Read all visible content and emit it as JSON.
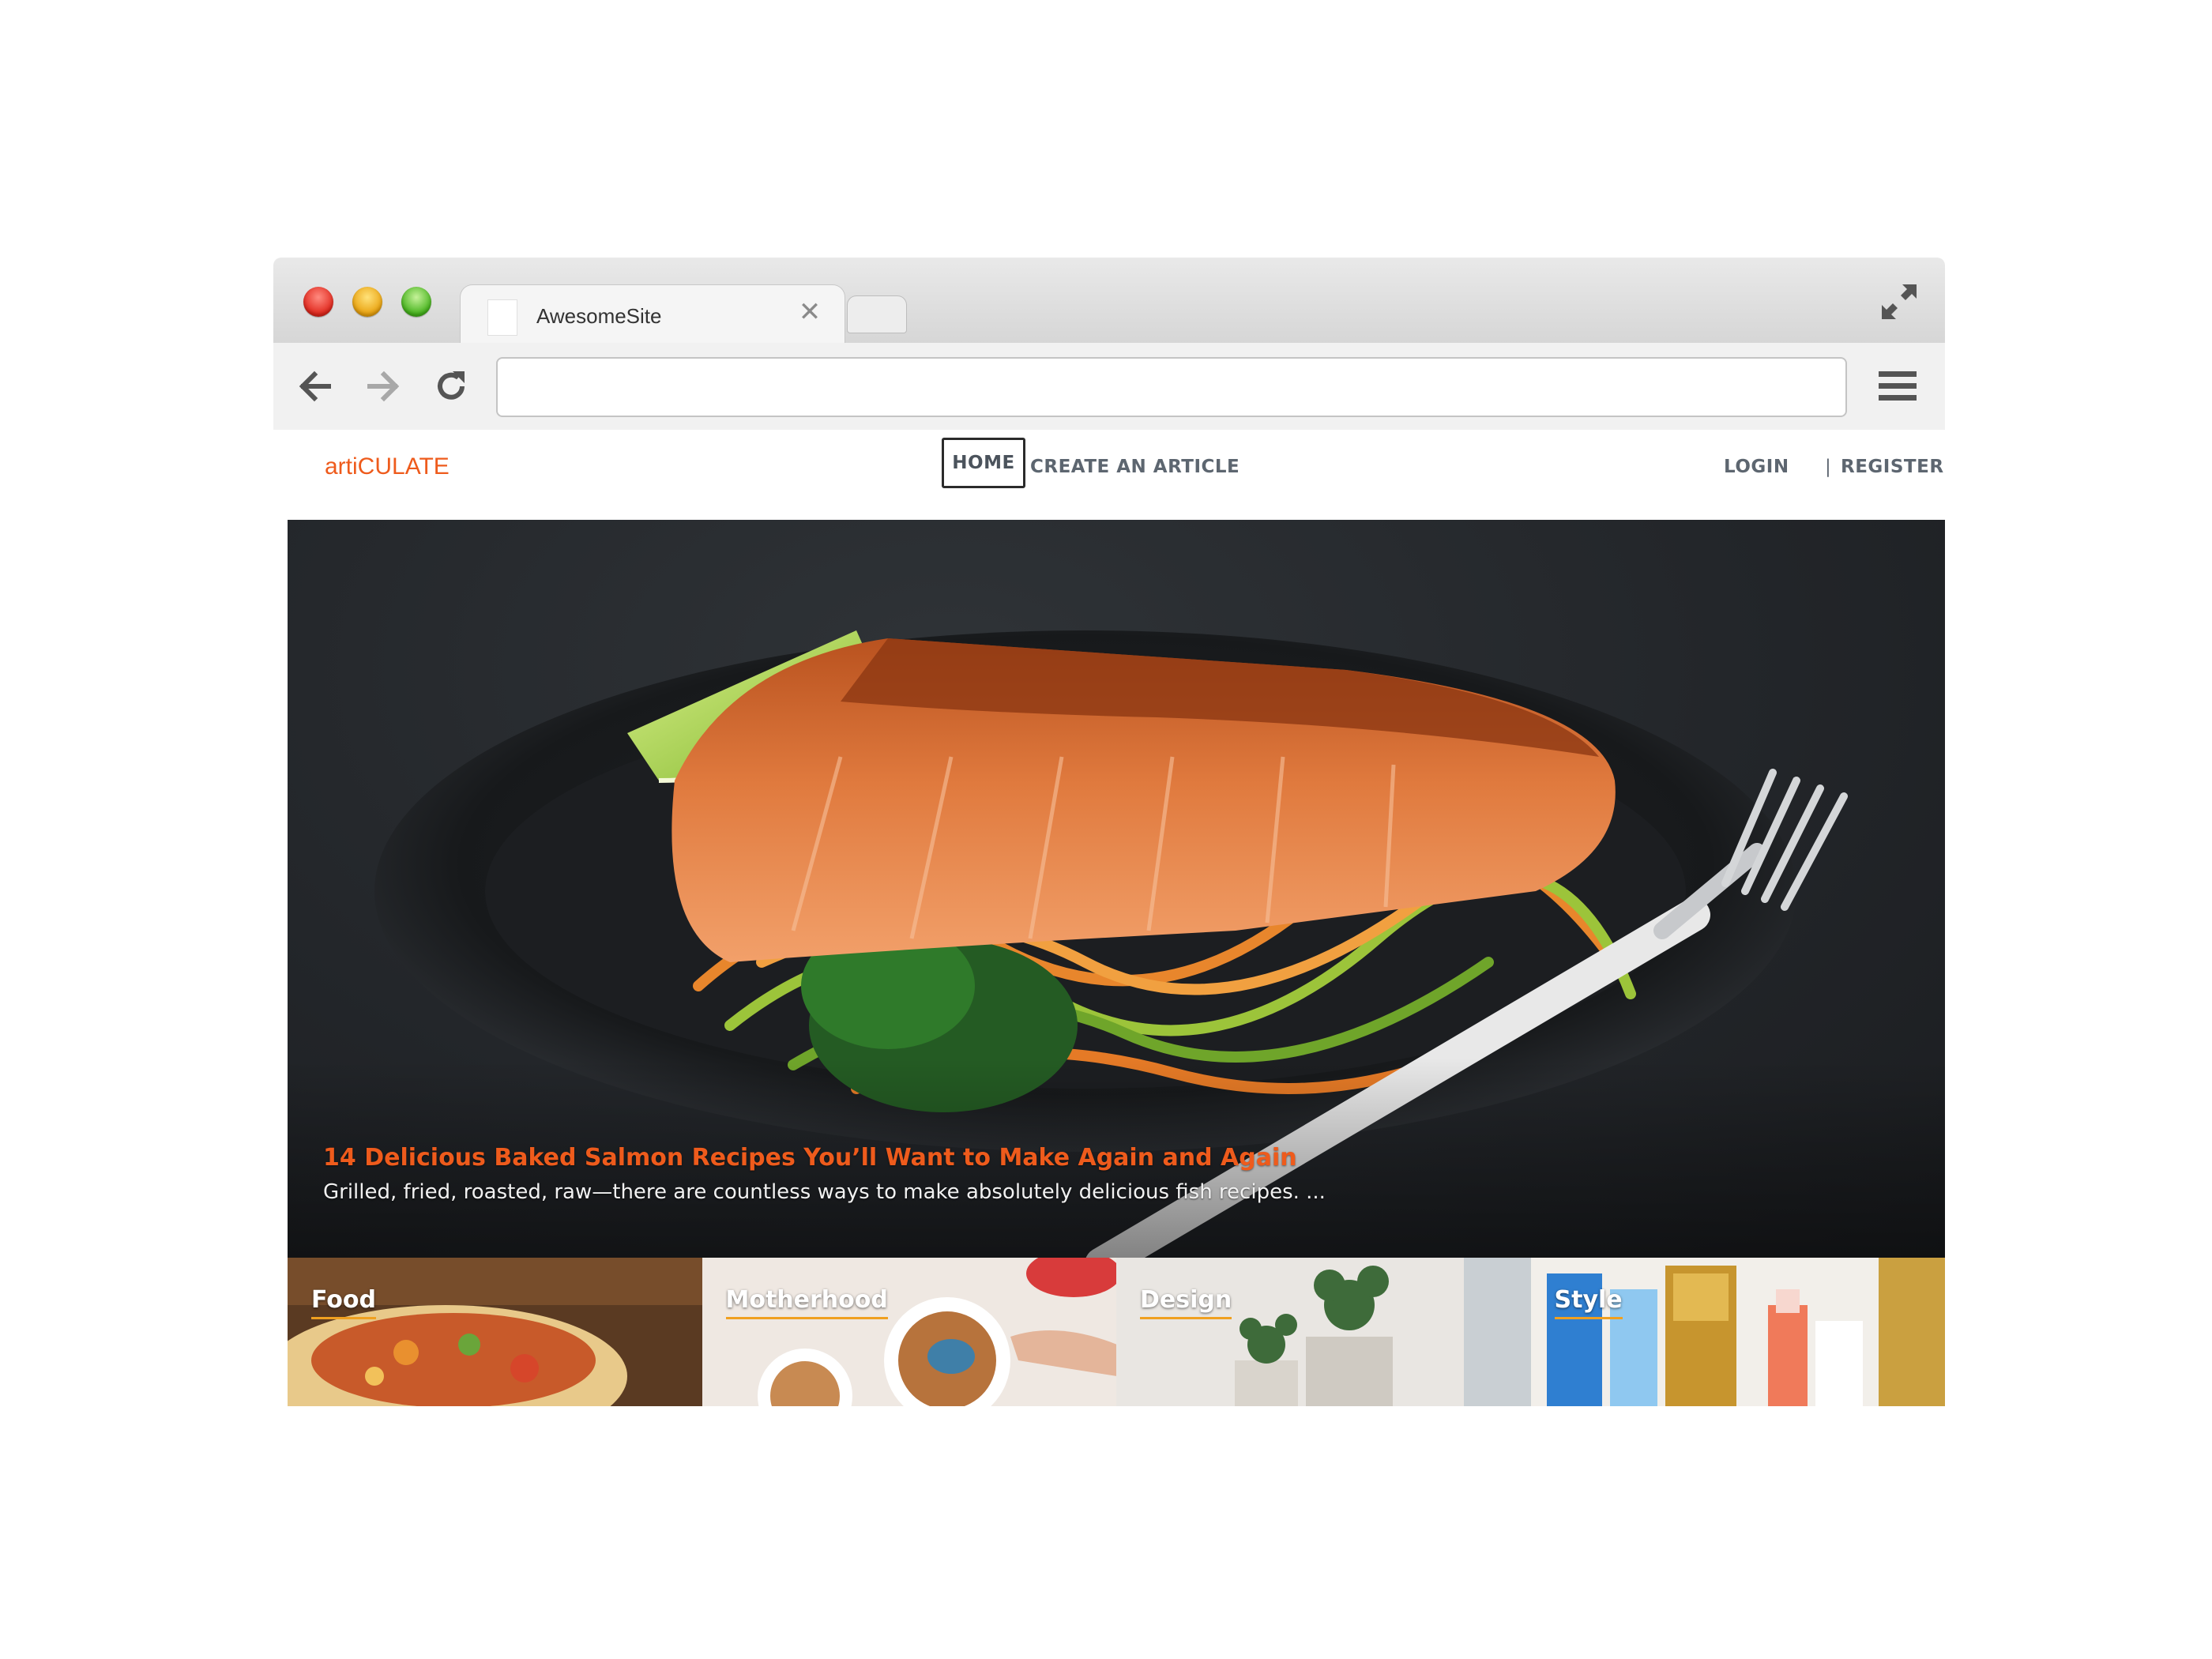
{
  "browser": {
    "tab_title": "AwesomeSite",
    "tab_close": "✕",
    "address_value": "",
    "icons": {
      "back": "arrow-left-icon",
      "forward": "arrow-right-icon",
      "reload": "reload-icon",
      "menu": "hamburger-menu-icon",
      "fullscreen": "expand-icon"
    }
  },
  "site": {
    "logo": "artiCULATE",
    "nav": {
      "home": "HOME",
      "create": "CREATE AN ARTICLE",
      "login": "LOGIN",
      "separator": "|",
      "register": "REGISTER"
    },
    "accent_color": "#ee5b1c"
  },
  "hero": {
    "title": "14 Delicious Baked Salmon Recipes You’ll Want to Make Again and Again",
    "excerpt": "Grilled, fried, roasted, raw—there are countless ways to make absolutely delicious fish recipes. ..."
  },
  "categories": [
    {
      "label": "Food"
    },
    {
      "label": "Motherhood"
    },
    {
      "label": "Design"
    },
    {
      "label": "Style"
    }
  ]
}
